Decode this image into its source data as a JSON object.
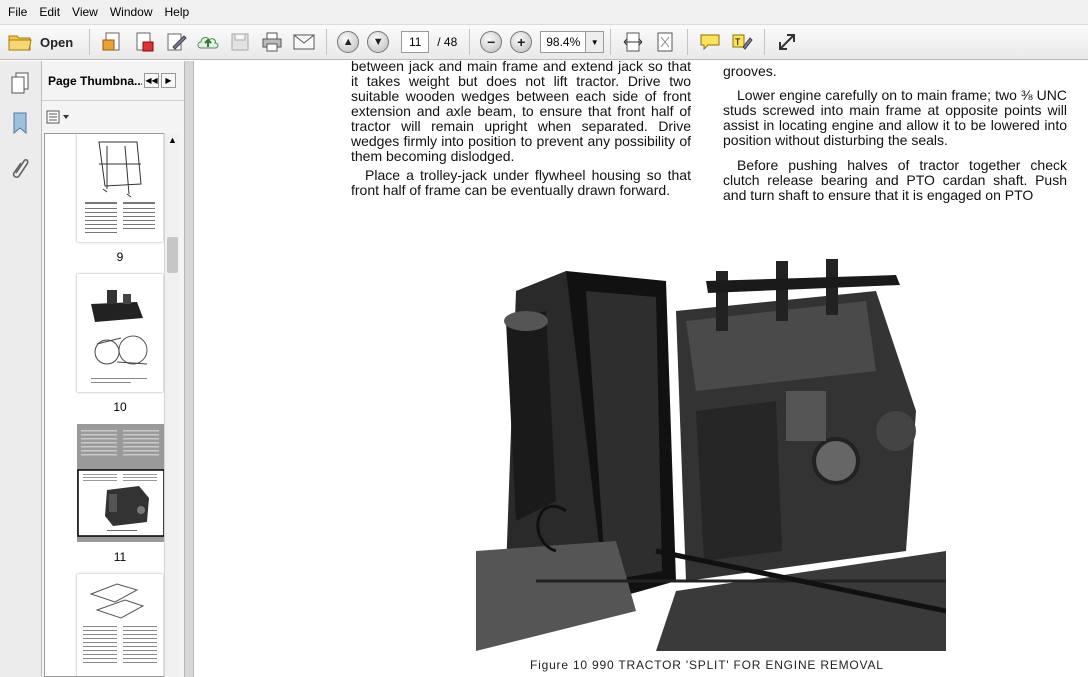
{
  "menu": [
    "File",
    "Edit",
    "View",
    "Window",
    "Help"
  ],
  "toolbar": {
    "open_label": "Open",
    "current_page": "11",
    "total_pages": "/ 48",
    "zoom": "98.4%"
  },
  "panel": {
    "title": "Page Thumbna...",
    "thumbnails": [
      {
        "label": "9"
      },
      {
        "label": "10"
      },
      {
        "label": "11"
      }
    ]
  },
  "document": {
    "left_col": {
      "p1": "between jack and main frame and extend jack so that it takes weight but does not lift tractor. Drive two suitable wooden wedges between each side of front extension and axle beam, to ensure that front half of tractor will remain upright when separated. Drive wedges firmly into position to prevent any possibility of them becoming dislodged.",
      "p2": "Place a trolley-jack under flywheel housing so that front half of frame can be eventually drawn forward."
    },
    "right_col": {
      "p0": "grooves.",
      "p1": "Lower engine carefully on to main frame; two ⅜ UNC studs screwed into main frame at opposite points will assist in locating engine and allow it to be lowered into position without disturbing the seals.",
      "p2": "Before pushing halves of tractor together check clutch release bearing and PTO cardan shaft. Push and turn shaft to ensure that it is engaged on PTO"
    },
    "figure_caption": "Figure 10   990 TRACTOR 'SPLIT' FOR ENGINE REMOVAL"
  },
  "icons": {
    "open": "folder-icon",
    "prev": "arrow-up-icon",
    "next": "arrow-down-icon",
    "zoom_out": "minus-icon",
    "zoom_in": "plus-icon"
  }
}
